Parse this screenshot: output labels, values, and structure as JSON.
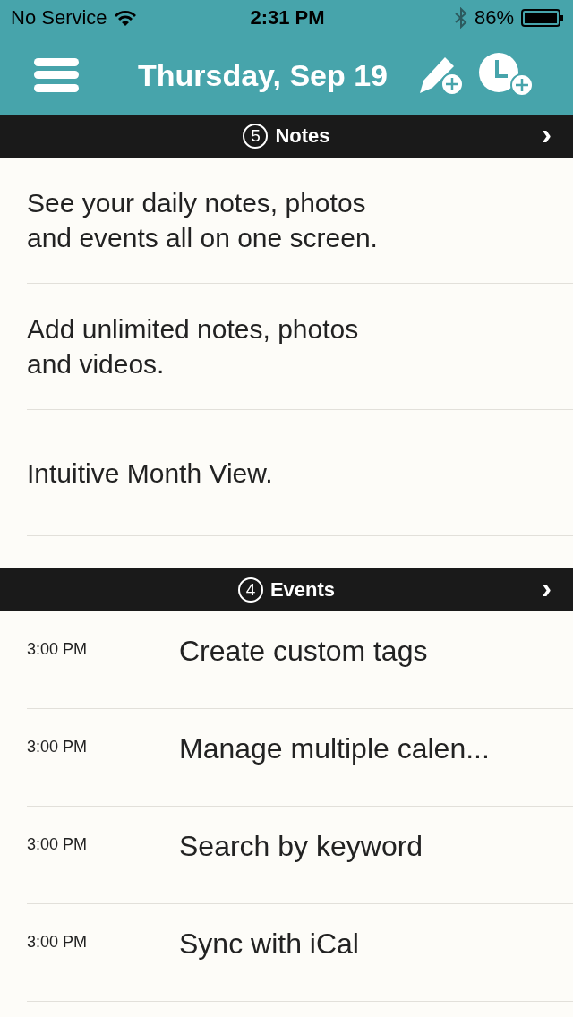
{
  "status_bar": {
    "carrier": "No Service",
    "time": "2:31 PM",
    "battery": "86%"
  },
  "nav_bar": {
    "title": "Thursday, Sep 19"
  },
  "notes": {
    "count": "5",
    "title": "Notes",
    "chevron": "›",
    "items": [
      "See your daily notes, photos\nand events all on one screen.",
      "Add unlimited notes, photos\nand videos.",
      "Intuitive Month View."
    ]
  },
  "events": {
    "count": "4",
    "title": "Events",
    "chevron": "›",
    "items": [
      {
        "time": "3:00 PM",
        "title": "Create custom tags"
      },
      {
        "time": "3:00 PM",
        "title": "Manage multiple calen..."
      },
      {
        "time": "3:00 PM",
        "title": "Search by keyword"
      },
      {
        "time": "3:00 PM",
        "title": "Sync with iCal"
      }
    ]
  }
}
